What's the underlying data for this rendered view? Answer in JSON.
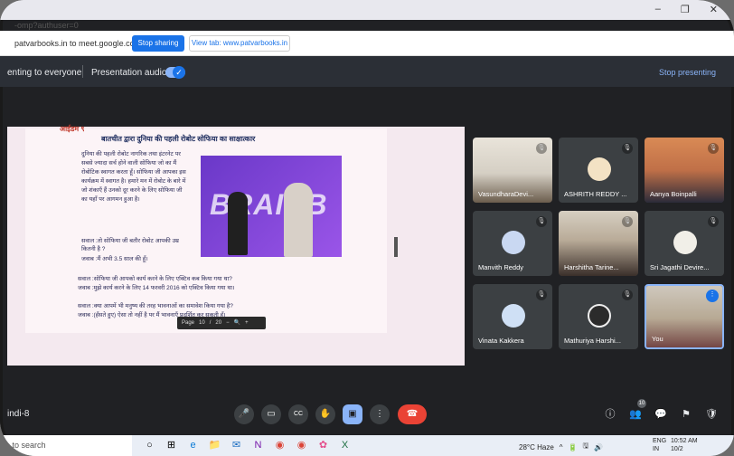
{
  "browser": {
    "url_fragment": "-omp?authuser=0",
    "window_controls": [
      "–",
      "❐",
      "✕"
    ]
  },
  "share_bar": {
    "message": "patvarbooks.in to meet.google.com",
    "stop_sharing": "Stop sharing",
    "view_tab": "View tab: www.patvarbooks.in"
  },
  "presentation_bar": {
    "presenting_text": "enting to everyone",
    "audio_label": "Presentation audio",
    "toggle_check": "✓",
    "stop_presenting": "Stop presenting"
  },
  "slide": {
    "label": "आईडम ९",
    "heading": "बातचीत द्वारा दुनिया की पहली रोबोट सोफिया का साक्षात्कार",
    "body": "दुनिया की पहली रोबोट नागरिक तथा इंटरनेट पर सबसे ज्यादा सर्च होने वाली सोफिया जो का मैं रोबोटिक स्वागत करता हूँ। सोफिया जी आपका इस कार्यक्रम में स्वागत है। हमारे मन में रोबोट के बारे में जो शंकाएँ हैं उनको दूर करने के लिए सोफिया जी का यहाँ पर आगमन हुआ है।",
    "photo_word": "BRAINB",
    "q1": "सवाल :तो सोफिया जी बतौर रोबोट आपकी उम्र कितनी है ?",
    "a1": "जवाब :मैं अभी 3.5 साल की हूँ।",
    "q2": "सवाल :सोफिया जी आपको कार्य करने के लिए एक्टिव कब किया गया था?",
    "a2": "जवाब :मुझे कार्य करने के लिए 14 फरवरी 2016 को एक्टिव किया गया था।",
    "q3": "सवाल :क्या आपमें भी मनुष्य की तरह भावनाओं का समावेश किया गया है?",
    "a3": "जवाब :(हँसते हुए) ऐसा तो नहीं है पर मैं भावनाएँ प्रदर्शित कर सकती हूँ।",
    "zoom": [
      "Page",
      "10",
      "/",
      "20",
      "−",
      "🔍",
      "+"
    ]
  },
  "participants": [
    {
      "name": "VasundharaDevi...",
      "type": "camera"
    },
    {
      "name": "ASHRITH REDDY ...",
      "type": "avatar"
    },
    {
      "name": "Aanya Boinpalli",
      "type": "camera"
    },
    {
      "name": "Manvith Reddy",
      "type": "avatar"
    },
    {
      "name": "Harshitha Tarine...",
      "type": "camera"
    },
    {
      "name": "Sri Jagathi Devire...",
      "type": "avatar"
    },
    {
      "name": "Vinata Kakkera",
      "type": "avatar"
    },
    {
      "name": "Mathuriya Harshi...",
      "type": "avatar"
    },
    {
      "name": "You",
      "type": "camera"
    }
  ],
  "mic_icon": "🎙",
  "meeting": {
    "name": "indi-8"
  },
  "controls": {
    "mic": "🎤",
    "camera": "▭",
    "captions": "CC",
    "hand": "✋",
    "present": "▣",
    "more": "⋮",
    "end": "☎",
    "info": "ⓘ",
    "people": "👥",
    "people_count": "10",
    "chat": "💬",
    "activities": "⚑",
    "host": "🛡"
  },
  "taskbar": {
    "search": "e to search",
    "icons": [
      "○",
      "⊞",
      "e",
      "📁",
      "✉",
      "N",
      "◉",
      "◉",
      "✿",
      "X"
    ],
    "weather": "28°C  Haze",
    "tray": [
      "^",
      "🔋",
      "🖫",
      "🔊"
    ],
    "lang": [
      "ENG",
      "IN"
    ],
    "time": "10:52 AM",
    "date": "10/2"
  }
}
